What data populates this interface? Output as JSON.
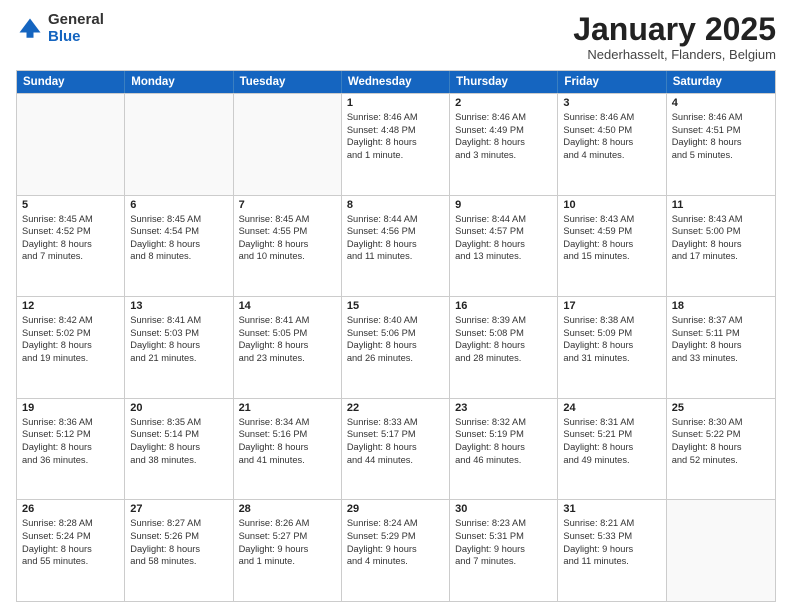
{
  "logo": {
    "general": "General",
    "blue": "Blue"
  },
  "title": "January 2025",
  "subtitle": "Nederhasselt, Flanders, Belgium",
  "days": [
    "Sunday",
    "Monday",
    "Tuesday",
    "Wednesday",
    "Thursday",
    "Friday",
    "Saturday"
  ],
  "weeks": [
    [
      {
        "day": "",
        "text": ""
      },
      {
        "day": "",
        "text": ""
      },
      {
        "day": "",
        "text": ""
      },
      {
        "day": "1",
        "text": "Sunrise: 8:46 AM\nSunset: 4:48 PM\nDaylight: 8 hours\nand 1 minute."
      },
      {
        "day": "2",
        "text": "Sunrise: 8:46 AM\nSunset: 4:49 PM\nDaylight: 8 hours\nand 3 minutes."
      },
      {
        "day": "3",
        "text": "Sunrise: 8:46 AM\nSunset: 4:50 PM\nDaylight: 8 hours\nand 4 minutes."
      },
      {
        "day": "4",
        "text": "Sunrise: 8:46 AM\nSunset: 4:51 PM\nDaylight: 8 hours\nand 5 minutes."
      }
    ],
    [
      {
        "day": "5",
        "text": "Sunrise: 8:45 AM\nSunset: 4:52 PM\nDaylight: 8 hours\nand 7 minutes."
      },
      {
        "day": "6",
        "text": "Sunrise: 8:45 AM\nSunset: 4:54 PM\nDaylight: 8 hours\nand 8 minutes."
      },
      {
        "day": "7",
        "text": "Sunrise: 8:45 AM\nSunset: 4:55 PM\nDaylight: 8 hours\nand 10 minutes."
      },
      {
        "day": "8",
        "text": "Sunrise: 8:44 AM\nSunset: 4:56 PM\nDaylight: 8 hours\nand 11 minutes."
      },
      {
        "day": "9",
        "text": "Sunrise: 8:44 AM\nSunset: 4:57 PM\nDaylight: 8 hours\nand 13 minutes."
      },
      {
        "day": "10",
        "text": "Sunrise: 8:43 AM\nSunset: 4:59 PM\nDaylight: 8 hours\nand 15 minutes."
      },
      {
        "day": "11",
        "text": "Sunrise: 8:43 AM\nSunset: 5:00 PM\nDaylight: 8 hours\nand 17 minutes."
      }
    ],
    [
      {
        "day": "12",
        "text": "Sunrise: 8:42 AM\nSunset: 5:02 PM\nDaylight: 8 hours\nand 19 minutes."
      },
      {
        "day": "13",
        "text": "Sunrise: 8:41 AM\nSunset: 5:03 PM\nDaylight: 8 hours\nand 21 minutes."
      },
      {
        "day": "14",
        "text": "Sunrise: 8:41 AM\nSunset: 5:05 PM\nDaylight: 8 hours\nand 23 minutes."
      },
      {
        "day": "15",
        "text": "Sunrise: 8:40 AM\nSunset: 5:06 PM\nDaylight: 8 hours\nand 26 minutes."
      },
      {
        "day": "16",
        "text": "Sunrise: 8:39 AM\nSunset: 5:08 PM\nDaylight: 8 hours\nand 28 minutes."
      },
      {
        "day": "17",
        "text": "Sunrise: 8:38 AM\nSunset: 5:09 PM\nDaylight: 8 hours\nand 31 minutes."
      },
      {
        "day": "18",
        "text": "Sunrise: 8:37 AM\nSunset: 5:11 PM\nDaylight: 8 hours\nand 33 minutes."
      }
    ],
    [
      {
        "day": "19",
        "text": "Sunrise: 8:36 AM\nSunset: 5:12 PM\nDaylight: 8 hours\nand 36 minutes."
      },
      {
        "day": "20",
        "text": "Sunrise: 8:35 AM\nSunset: 5:14 PM\nDaylight: 8 hours\nand 38 minutes."
      },
      {
        "day": "21",
        "text": "Sunrise: 8:34 AM\nSunset: 5:16 PM\nDaylight: 8 hours\nand 41 minutes."
      },
      {
        "day": "22",
        "text": "Sunrise: 8:33 AM\nSunset: 5:17 PM\nDaylight: 8 hours\nand 44 minutes."
      },
      {
        "day": "23",
        "text": "Sunrise: 8:32 AM\nSunset: 5:19 PM\nDaylight: 8 hours\nand 46 minutes."
      },
      {
        "day": "24",
        "text": "Sunrise: 8:31 AM\nSunset: 5:21 PM\nDaylight: 8 hours\nand 49 minutes."
      },
      {
        "day": "25",
        "text": "Sunrise: 8:30 AM\nSunset: 5:22 PM\nDaylight: 8 hours\nand 52 minutes."
      }
    ],
    [
      {
        "day": "26",
        "text": "Sunrise: 8:28 AM\nSunset: 5:24 PM\nDaylight: 8 hours\nand 55 minutes."
      },
      {
        "day": "27",
        "text": "Sunrise: 8:27 AM\nSunset: 5:26 PM\nDaylight: 8 hours\nand 58 minutes."
      },
      {
        "day": "28",
        "text": "Sunrise: 8:26 AM\nSunset: 5:27 PM\nDaylight: 9 hours\nand 1 minute."
      },
      {
        "day": "29",
        "text": "Sunrise: 8:24 AM\nSunset: 5:29 PM\nDaylight: 9 hours\nand 4 minutes."
      },
      {
        "day": "30",
        "text": "Sunrise: 8:23 AM\nSunset: 5:31 PM\nDaylight: 9 hours\nand 7 minutes."
      },
      {
        "day": "31",
        "text": "Sunrise: 8:21 AM\nSunset: 5:33 PM\nDaylight: 9 hours\nand 11 minutes."
      },
      {
        "day": "",
        "text": ""
      }
    ]
  ]
}
